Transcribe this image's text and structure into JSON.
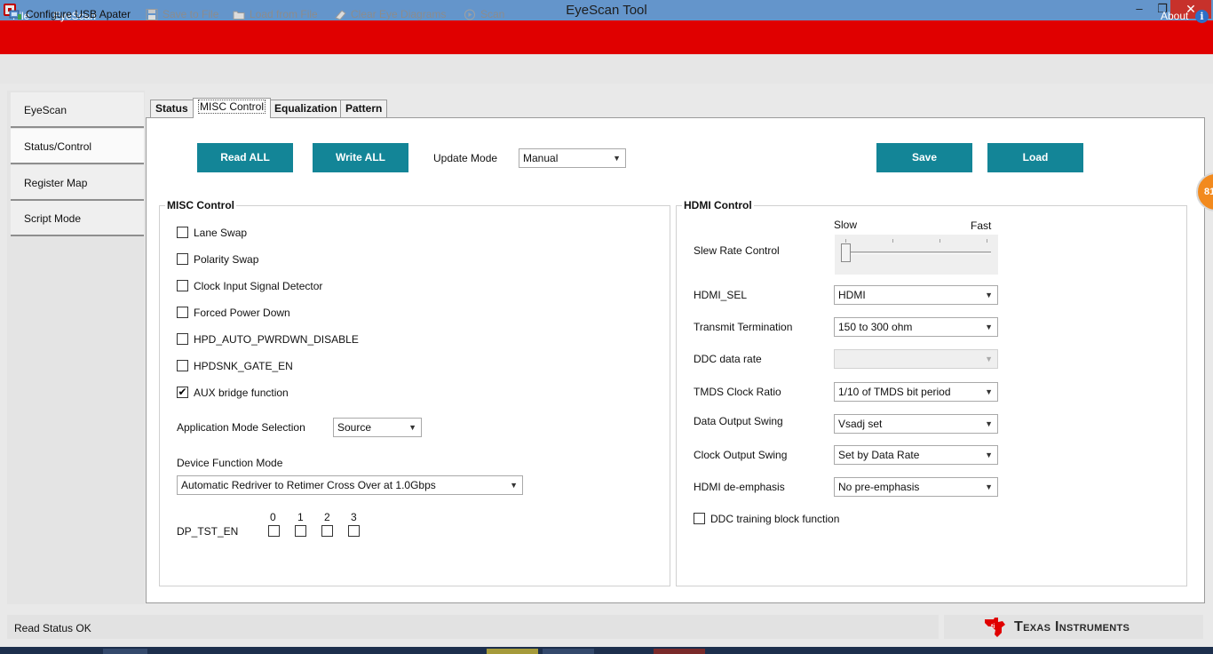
{
  "window": {
    "title": "EyeScan Tool",
    "minimize": "–",
    "maximize": "❐",
    "close": "✕"
  },
  "menu": {
    "file": "File",
    "eyescan": "EyeScan",
    "about": "About",
    "info_icon": "i"
  },
  "toolbar": {
    "configure_usb": "Configure USB Apater",
    "save_to_file": "Save to File",
    "load_from_file": "Load from File",
    "clear_eye_diagrams": "Clear Eye Diagrams",
    "scan": "Scan"
  },
  "sidebar": {
    "items": [
      {
        "label": "EyeScan",
        "selected": false
      },
      {
        "label": "Status/Control",
        "selected": true
      },
      {
        "label": "Register Map",
        "selected": false
      },
      {
        "label": "Script Mode",
        "selected": false
      }
    ]
  },
  "tabs": [
    {
      "label": "Status"
    },
    {
      "label": "MISC Control",
      "selected": true
    },
    {
      "label": "Equalization"
    },
    {
      "label": "Pattern"
    }
  ],
  "actions": {
    "read_all": "Read ALL",
    "write_all": "Write ALL",
    "update_mode_label": "Update Mode",
    "update_mode_value": "Manual",
    "save": "Save",
    "load": "Load"
  },
  "misc": {
    "title": "MISC Control",
    "checkboxes": [
      {
        "label": "Lane Swap",
        "checked": false
      },
      {
        "label": "Polarity Swap",
        "checked": false
      },
      {
        "label": "Clock Input Signal Detector",
        "checked": false
      },
      {
        "label": "Forced Power Down",
        "checked": false
      },
      {
        "label": "HPD_AUTO_PWRDWN_DISABLE",
        "checked": false
      },
      {
        "label": "HPDSNK_GATE_EN",
        "checked": false
      },
      {
        "label": "AUX bridge function",
        "checked": true
      }
    ],
    "app_mode_label": "Application Mode Selection",
    "app_mode_value": "Source",
    "device_function_label": "Device Function Mode",
    "device_function_value": "Automatic Redriver to Retimer Cross Over at 1.0Gbps",
    "dp_tst_en_label": "DP_TST_EN",
    "dp_tst_en_bits": [
      "0",
      "1",
      "2",
      "3"
    ],
    "check_mark": "✔"
  },
  "hdmi": {
    "title": "HDMI Control",
    "slew_label": "Slew Rate Control",
    "slew_slow": "Slow",
    "slew_fast": "Fast",
    "slew_level": 0,
    "hdmi_sel_label": "HDMI_SEL",
    "hdmi_sel_value": "HDMI",
    "transmit_term_label": "Transmit Termination",
    "transmit_term_value": "150 to 300 ohm",
    "ddc_rate_label": "DDC data rate",
    "ddc_rate_value": "",
    "tmds_label": "TMDS Clock Ratio",
    "tmds_value": "1/10 of TMDS bit period",
    "data_swing_label": "Data Output Swing",
    "data_swing_value": "Vsadj set",
    "clock_swing_label": "Clock Output Swing",
    "clock_swing_value": "Set by Data Rate",
    "deemph_label": "HDMI de-emphasis",
    "deemph_value": "No pre-emphasis",
    "ddc_training_label": "DDC training block function"
  },
  "status": {
    "text": "Read Status OK"
  },
  "brand": {
    "name": "Texas Instruments",
    "logo_color": "#e00000"
  },
  "overlay": {
    "badge": "81"
  },
  "colors": {
    "menubar": "#e00000",
    "titlebar": "#6495cb",
    "accent_button": "#138597"
  },
  "arrow_glyph": "▼"
}
